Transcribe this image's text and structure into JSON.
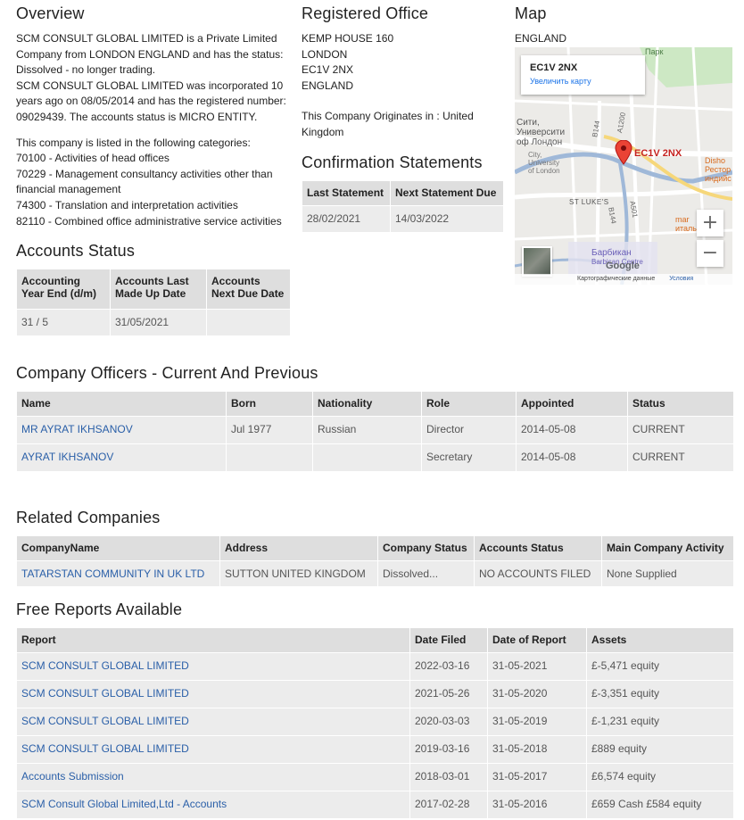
{
  "overview": {
    "heading": "Overview",
    "p1": [
      "SCM CONSULT GLOBAL LIMITED is a Private Limited",
      "Company from LONDON ENGLAND and has the status:",
      "Dissolved - no longer trading."
    ],
    "p2": [
      "SCM CONSULT GLOBAL LIMITED was incorporated 10",
      "years ago on 08/05/2014 and has the registered number:",
      "09029439. The accounts status is MICRO ENTITY."
    ],
    "categories_intro": "This company is listed in the following categories:",
    "categories": [
      "70100 - Activities of head offices",
      "70229 - Management consultancy activities other than",
      "financial management",
      "74300 - Translation and interpretation activities",
      "82110 - Combined office administrative service activities"
    ]
  },
  "registered_office": {
    "heading": "Registered Office",
    "address": [
      "KEMP HOUSE 160",
      "LONDON",
      "EC1V 2NX",
      "ENGLAND"
    ],
    "origin": [
      "This Company Originates in : United",
      "Kingdom"
    ]
  },
  "map": {
    "heading": "Map",
    "country": "ENGLAND",
    "card_postcode": "EC1V 2NX",
    "card_link": "Увеличить карту",
    "pin_label": "EC1V 2NX",
    "labels": {
      "city": "Сити,",
      "uni1": "Университи",
      "uni2": "оф Лондон",
      "city_en": "City,",
      "uni_en": "University",
      "of_london": "of London",
      "stlukes": "ST LUKE'S",
      "barbican": "Барбикан",
      "barbican_en": "Barbican Centre",
      "park": "Парк",
      "b144": "B144",
      "a1200": "A1200",
      "a501": "A501",
      "b144b": "B144",
      "google": "Google",
      "footer_data": "Картографические данные",
      "footer_terms": "Условия",
      "dishoom": "Disho",
      "restaurant": "Рестор",
      "indian": "индийс",
      "italian": "итальянской",
      "mar": "mar"
    },
    "zoom_in": "+",
    "zoom_out": "−"
  },
  "confirmation": {
    "heading": "Confirmation Statements",
    "headers": [
      "Last Statement",
      "Next Statement Due"
    ],
    "row": [
      "28/02/2021",
      "14/03/2022"
    ]
  },
  "accounts_status": {
    "heading": "Accounts Status",
    "headers": [
      "Accounting Year End (d/m)",
      "Accounts Last Made Up Date",
      "Accounts Next Due Date"
    ],
    "row": [
      "31 / 5",
      "31/05/2021",
      ""
    ]
  },
  "officers": {
    "heading": "Company Officers - Current And Previous",
    "headers": [
      "Name",
      "Born",
      "Nationality",
      "Role",
      "Appointed",
      "Status"
    ],
    "rows": [
      {
        "name": "MR AYRAT IKHSANOV",
        "born": "Jul 1977",
        "nationality": "Russian",
        "role": "Director",
        "appointed": "2014-05-08",
        "status": "CURRENT"
      },
      {
        "name": "AYRAT IKHSANOV",
        "born": "",
        "nationality": "",
        "role": "Secretary",
        "appointed": "2014-05-08",
        "status": "CURRENT"
      }
    ]
  },
  "related": {
    "heading": "Related Companies",
    "headers": [
      "CompanyName",
      "Address",
      "Company Status",
      "Accounts Status",
      "Main Company Activity"
    ],
    "rows": [
      {
        "name": "TATARSTAN COMMUNITY IN UK LTD",
        "address": "SUTTON UNITED KINGDOM",
        "status": "Dissolved...",
        "accounts": "NO ACCOUNTS FILED",
        "activity": "None Supplied"
      }
    ]
  },
  "reports": {
    "heading": "Free Reports Available",
    "headers": [
      "Report",
      "Date Filed",
      "Date of Report",
      "Assets"
    ],
    "rows": [
      {
        "report": "SCM CONSULT GLOBAL LIMITED",
        "filed": "2022-03-16",
        "date": "31-05-2021",
        "assets": "£-5,471 equity"
      },
      {
        "report": "SCM CONSULT GLOBAL LIMITED",
        "filed": "2021-05-26",
        "date": "31-05-2020",
        "assets": "£-3,351 equity"
      },
      {
        "report": "SCM CONSULT GLOBAL LIMITED",
        "filed": "2020-03-03",
        "date": "31-05-2019",
        "assets": "£-1,231 equity"
      },
      {
        "report": "SCM CONSULT GLOBAL LIMITED",
        "filed": "2019-03-16",
        "date": "31-05-2018",
        "assets": "£889 equity"
      },
      {
        "report": "Accounts Submission",
        "filed": "2018-03-01",
        "date": "31-05-2017",
        "assets": "£6,574 equity"
      },
      {
        "report": "SCM Consult Global Limited,Ltd - Accounts",
        "filed": "2017-02-28",
        "date": "31-05-2016",
        "assets": "£659 Cash £584 equity"
      }
    ]
  }
}
